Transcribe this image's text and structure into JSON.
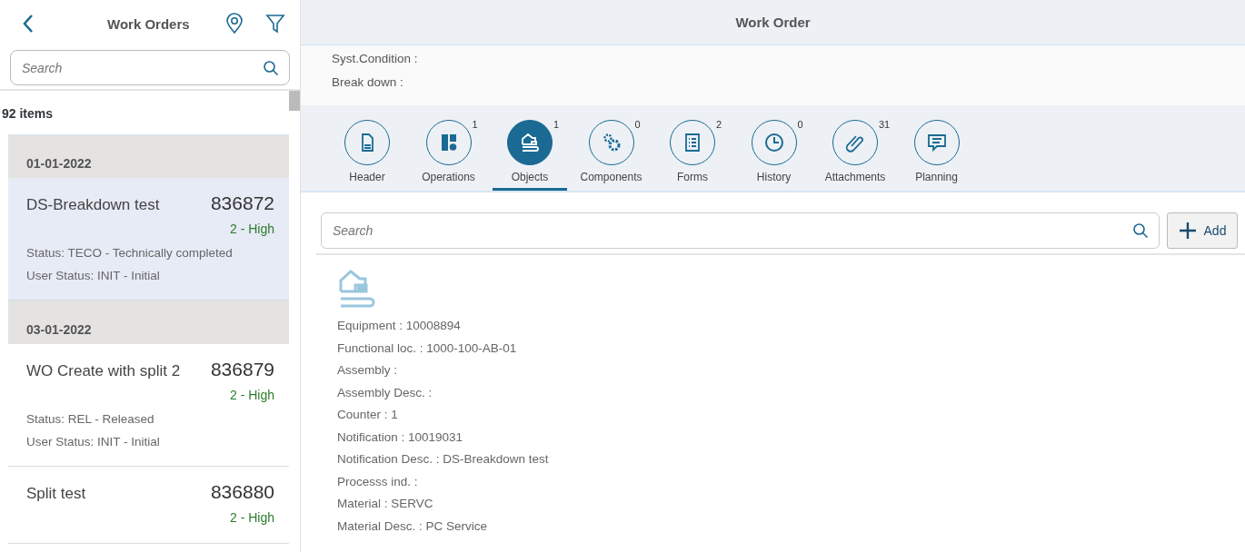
{
  "list_panel": {
    "title": "Work Orders",
    "search": {
      "placeholder": "Search"
    },
    "count": "92 items",
    "groups": [
      {
        "date": "01-01-2022",
        "orders": [
          {
            "title": "DS-Breakdown test",
            "number": "836872",
            "priority": "2 - High",
            "status": "Status: TECO - Technically completed",
            "user_status": "User Status: INIT - Initial",
            "selected": true
          }
        ]
      },
      {
        "date": "03-01-2022",
        "orders": [
          {
            "title": "WO Create with split 2",
            "number": "836879",
            "priority": "2 - High",
            "status": "Status: REL - Released",
            "user_status": "User Status: INIT - Initial",
            "selected": false
          },
          {
            "title": "Split test",
            "number": "836880",
            "priority": "2 - High",
            "selected": false
          }
        ]
      }
    ]
  },
  "detail": {
    "title": "Work Order",
    "info": [
      "Syst.Condition :",
      "Break down :"
    ],
    "tabs": [
      {
        "kind": "header",
        "label": "Header",
        "selected": false
      },
      {
        "kind": "operations",
        "label": "Operations",
        "count": "1",
        "selected": false
      },
      {
        "kind": "objects",
        "label": "Objects",
        "count": "1",
        "selected": true
      },
      {
        "kind": "components",
        "label": "Components",
        "count": "0",
        "selected": false
      },
      {
        "kind": "forms",
        "label": "Forms",
        "count": "2",
        "selected": false
      },
      {
        "kind": "history",
        "label": "History",
        "count": "0",
        "selected": false
      },
      {
        "kind": "attachments",
        "label": "Attachments",
        "count": "31",
        "selected": false
      },
      {
        "kind": "planning",
        "label": "Planning",
        "selected": false
      }
    ],
    "search": {
      "placeholder": "Search"
    },
    "add_button": "Add",
    "object_fields": [
      "Equipment : 10008894",
      "Functional loc. : 1000-100-AB-01",
      "Assembly :",
      "Assembly Desc. :",
      "Counter : 1",
      "Notification : 10019031",
      "Notification Desc. : DS-Breakdown test",
      "Processs ind. :",
      "Material : SERVC",
      "Material Desc. : PC Service"
    ]
  }
}
